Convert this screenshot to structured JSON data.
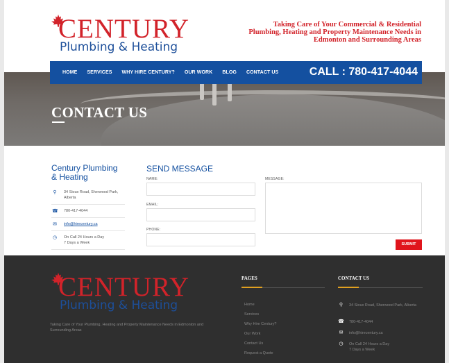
{
  "brand": {
    "name": "CENTURY",
    "sub": "Plumbing & Heating",
    "tagline": "Taking Care of Your Commercial & Residential Plumbing, Heating and Property Maintenance Needs in Edmonton and Surrounding Areas",
    "red": "#d2232a",
    "blue": "#1450a0"
  },
  "nav": {
    "items": [
      {
        "label": "HOME"
      },
      {
        "label": "SERVICES"
      },
      {
        "label": "WHY HIRE CENTURY?"
      },
      {
        "label": "OUR WORK"
      },
      {
        "label": "BLOG"
      },
      {
        "label": "CONTACT US"
      }
    ],
    "call": "CALL : 780-417-4044"
  },
  "hero": {
    "title": "CONTACT US"
  },
  "info": {
    "title": "Century Plumbing & Heating",
    "address": "34 Sioux Road, Sherwood Park, Alberta",
    "phone": "780-417-4044",
    "email": "info@hirecentury.ca",
    "hours_line1": "On Call 24 Hours a Day",
    "hours_line2": "7 Days a Week"
  },
  "form": {
    "title": "SEND MESSAGE",
    "name_label": "NAME:",
    "email_label": "EMAIL:",
    "phone_label": "PHONE:",
    "message_label": "MESSAGE:",
    "submit": "SUBMIT"
  },
  "footer": {
    "tagline": "Taking Care of Your Plumbing, Heating and Property Maintenance Needs in Edmonton and Surrounding Areas",
    "pages_title": "PAGES",
    "pages": [
      {
        "label": "Home"
      },
      {
        "label": "Services"
      },
      {
        "label": "Why Hire Century?"
      },
      {
        "label": "Our Work"
      },
      {
        "label": "Contact Us"
      },
      {
        "label": "Request a Quote"
      }
    ],
    "contact_title": "CONTACT US",
    "address": "34 Sioux Road, Sherwood Park, Alberta",
    "phone": "780-417-4044",
    "email": "info@hirecentury.ca",
    "hours_line1": "On Call 24 Hours a Day",
    "hours_line2": "7 Days a Week"
  }
}
